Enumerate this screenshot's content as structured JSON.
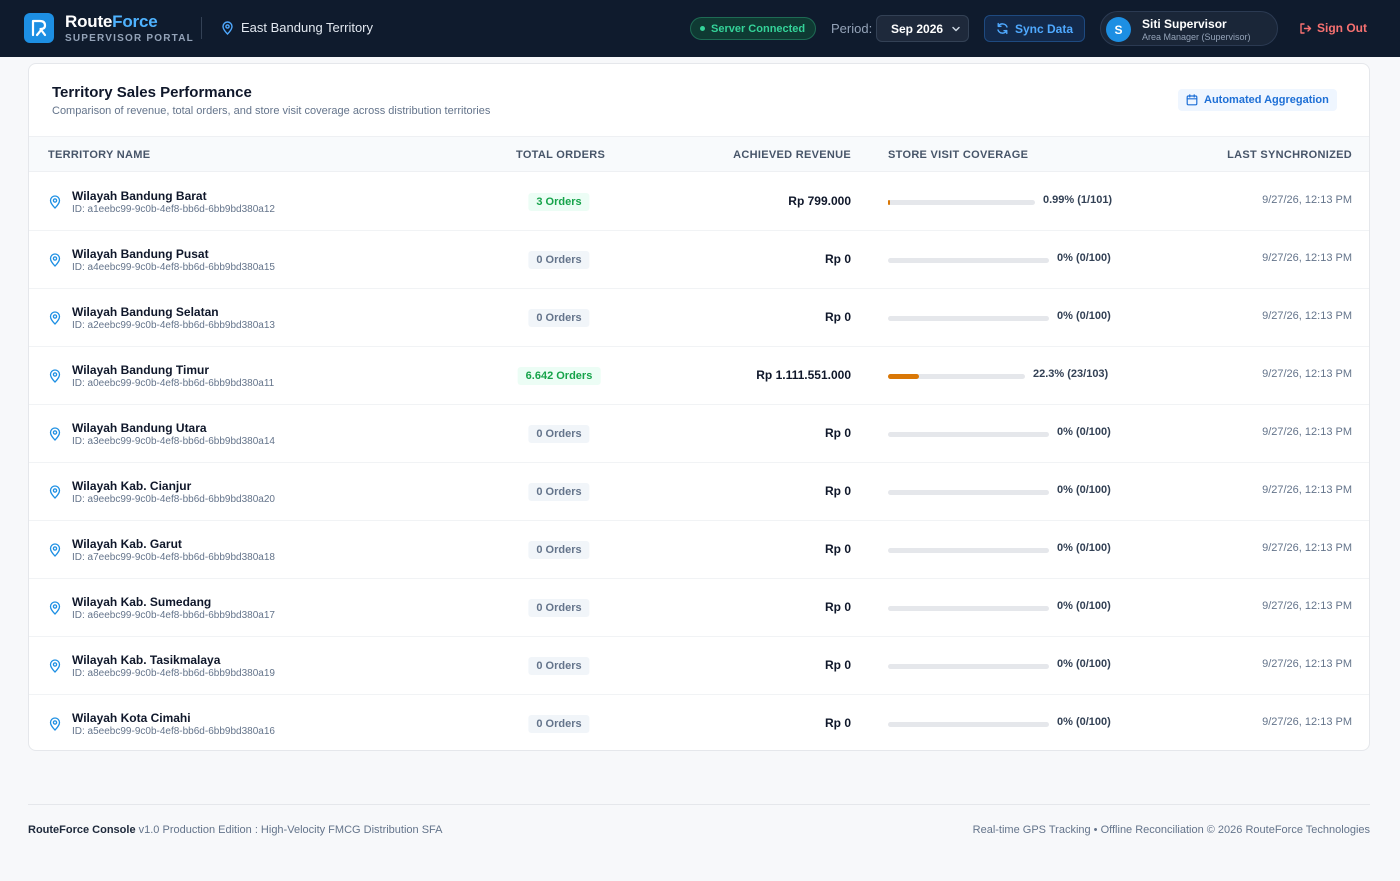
{
  "header": {
    "brand_main": "Route",
    "brand_accent": "Force",
    "brand_sub": "SUPERVISOR PORTAL",
    "territory": "East Bandung Territory",
    "server_status": "Server Connected",
    "period_label": "Period:",
    "period_value": "Sep 2026",
    "sync_label": "Sync Data",
    "user_initial": "S",
    "user_name": "Siti Supervisor",
    "user_role": "Area Manager (Supervisor)",
    "signout_label": "Sign Out"
  },
  "card": {
    "title": "Territory Sales Performance",
    "subtitle": "Comparison of revenue, total orders, and store visit coverage across distribution territories",
    "badge": "Automated Aggregation"
  },
  "table": {
    "headers": [
      "TERRITORY NAME",
      "TOTAL ORDERS",
      "ACHIEVED REVENUE",
      "STORE VISIT COVERAGE",
      "LAST SYNCHRONIZED"
    ],
    "rows": [
      {
        "name": "Wilayah Bandung Barat",
        "id": "ID: a1eebc99-9c0b-4ef8-bb6d-6bb9bd380a12",
        "orders": "3 Orders",
        "positive": true,
        "revenue": "Rp 799.000",
        "coverage_pct": 0.99,
        "coverage": "0.99% (1/101)",
        "synced": "9/27/26, 12:13 PM"
      },
      {
        "name": "Wilayah Bandung Pusat",
        "id": "ID: a4eebc99-9c0b-4ef8-bb6d-6bb9bd380a15",
        "orders": "0 Orders",
        "positive": false,
        "revenue": "Rp 0",
        "coverage_pct": 0,
        "coverage": "0% (0/100)",
        "synced": "9/27/26, 12:13 PM"
      },
      {
        "name": "Wilayah Bandung Selatan",
        "id": "ID: a2eebc99-9c0b-4ef8-bb6d-6bb9bd380a13",
        "orders": "0 Orders",
        "positive": false,
        "revenue": "Rp 0",
        "coverage_pct": 0,
        "coverage": "0% (0/100)",
        "synced": "9/27/26, 12:13 PM"
      },
      {
        "name": "Wilayah Bandung Timur",
        "id": "ID: a0eebc99-9c0b-4ef8-bb6d-6bb9bd380a11",
        "orders": "6.642 Orders",
        "positive": true,
        "revenue": "Rp 1.111.551.000",
        "coverage_pct": 22.3,
        "coverage": "22.3% (23/103)",
        "synced": "9/27/26, 12:13 PM"
      },
      {
        "name": "Wilayah Bandung Utara",
        "id": "ID: a3eebc99-9c0b-4ef8-bb6d-6bb9bd380a14",
        "orders": "0 Orders",
        "positive": false,
        "revenue": "Rp 0",
        "coverage_pct": 0,
        "coverage": "0% (0/100)",
        "synced": "9/27/26, 12:13 PM"
      },
      {
        "name": "Wilayah Kab. Cianjur",
        "id": "ID: a9eebc99-9c0b-4ef8-bb6d-6bb9bd380a20",
        "orders": "0 Orders",
        "positive": false,
        "revenue": "Rp 0",
        "coverage_pct": 0,
        "coverage": "0% (0/100)",
        "synced": "9/27/26, 12:13 PM"
      },
      {
        "name": "Wilayah Kab. Garut",
        "id": "ID: a7eebc99-9c0b-4ef8-bb6d-6bb9bd380a18",
        "orders": "0 Orders",
        "positive": false,
        "revenue": "Rp 0",
        "coverage_pct": 0,
        "coverage": "0% (0/100)",
        "synced": "9/27/26, 12:13 PM"
      },
      {
        "name": "Wilayah Kab. Sumedang",
        "id": "ID: a6eebc99-9c0b-4ef8-bb6d-6bb9bd380a17",
        "orders": "0 Orders",
        "positive": false,
        "revenue": "Rp 0",
        "coverage_pct": 0,
        "coverage": "0% (0/100)",
        "synced": "9/27/26, 12:13 PM"
      },
      {
        "name": "Wilayah Kab. Tasikmalaya",
        "id": "ID: a8eebc99-9c0b-4ef8-bb6d-6bb9bd380a19",
        "orders": "0 Orders",
        "positive": false,
        "revenue": "Rp 0",
        "coverage_pct": 0,
        "coverage": "0% (0/100)",
        "synced": "9/27/26, 12:13 PM"
      },
      {
        "name": "Wilayah Kota Cimahi",
        "id": "ID: a5eebc99-9c0b-4ef8-bb6d-6bb9bd380a16",
        "orders": "0 Orders",
        "positive": false,
        "revenue": "Rp 0",
        "coverage_pct": 0,
        "coverage": "0% (0/100)",
        "synced": "9/27/26, 12:13 PM"
      }
    ]
  },
  "footer": {
    "brand": "RouteForce Console",
    "tagline": " v1.0 Production Edition : High-Velocity FMCG Distribution SFA",
    "right": "Real-time GPS Tracking • Offline Reconciliation   © 2026 RouteForce Technologies"
  },
  "colors": {
    "header_bg": "#0f1b2d",
    "accent": "#1d8fe3",
    "positive": "#16a34a",
    "progress": "#d97706",
    "danger": "#f87171"
  }
}
